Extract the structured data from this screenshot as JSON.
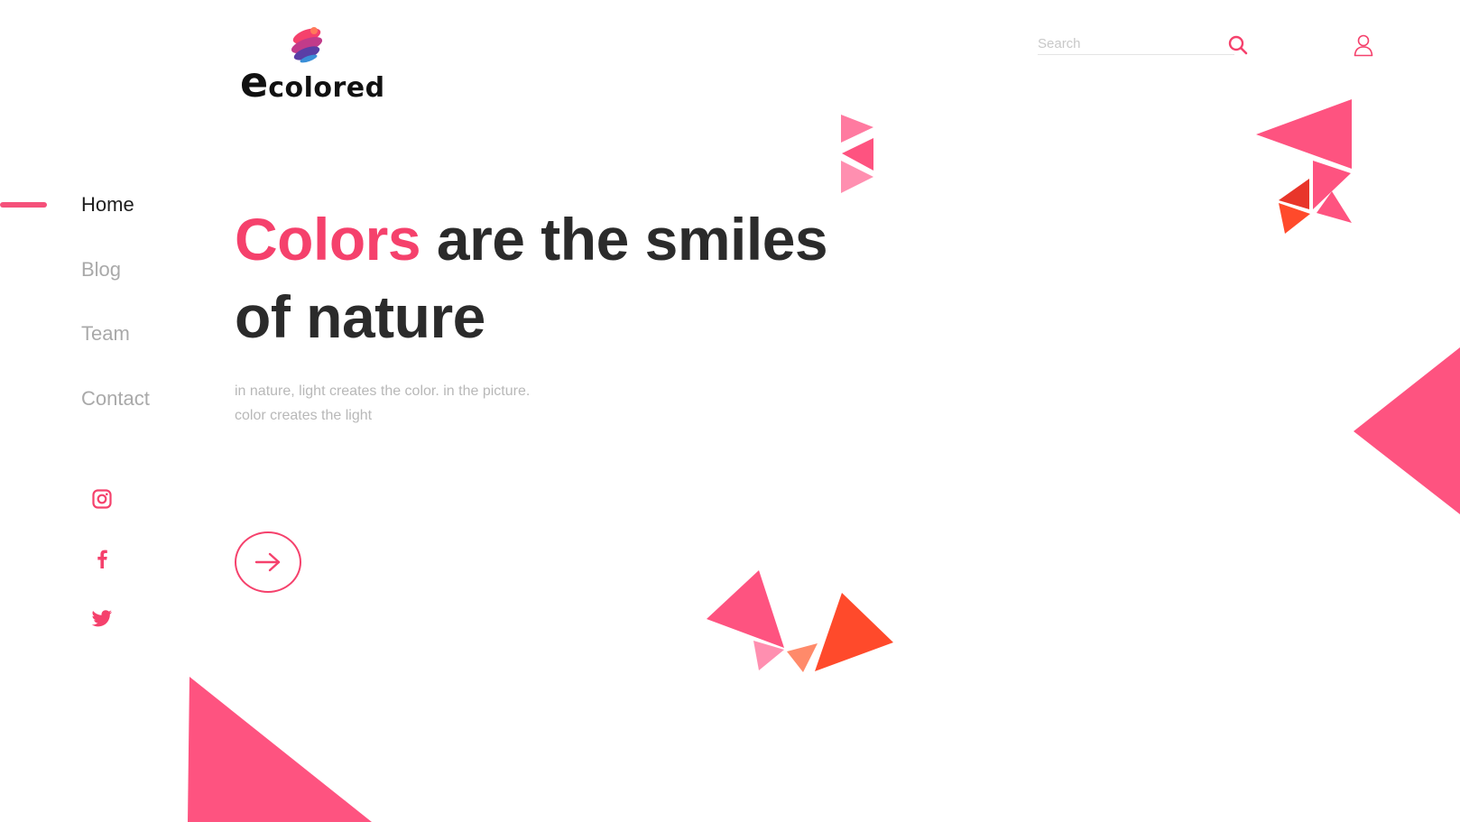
{
  "brand": {
    "logo_initial": "e",
    "logo_rest": "colored"
  },
  "header": {
    "search_placeholder": "Search",
    "search_icon": "search-icon",
    "user_icon": "user-icon"
  },
  "nav": {
    "items": [
      {
        "label": "Home",
        "active": true
      },
      {
        "label": "Blog",
        "active": false
      },
      {
        "label": "Team",
        "active": false
      },
      {
        "label": "Contact",
        "active": false
      }
    ]
  },
  "social": [
    "instagram-icon",
    "facebook-icon",
    "twitter-icon"
  ],
  "hero": {
    "title_accent": "Colors",
    "title_rest": " are the smiles of nature",
    "subtitle_line1": "in nature, light creates the color. in the picture.",
    "subtitle_line2": "color creates the light",
    "cta_icon": "arrow-right-icon"
  },
  "colors": {
    "accent": "#f5416c",
    "pink": "#fe5380",
    "light_pink": "#ff8fb0",
    "orange": "#ff4a2b",
    "red": "#e8352a",
    "salmon": "#ff8a6a",
    "text_dark": "#2b2b2b",
    "text_muted": "#a9a9a9"
  }
}
